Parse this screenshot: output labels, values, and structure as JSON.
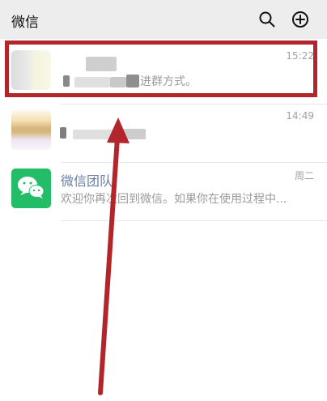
{
  "header": {
    "title": "微信",
    "search_icon": "search-icon",
    "add_icon": "plus-circle-icon"
  },
  "chats": [
    {
      "name": "",
      "time": "15:22",
      "preview": "进群方式。",
      "avatar": "blurred-avatar"
    },
    {
      "name": "",
      "time": "14:49",
      "preview": "",
      "avatar": "blurred-avatar"
    },
    {
      "name": "微信团队",
      "time": "周二",
      "preview": "欢迎你再次回到微信。如果你在使用过程中...",
      "avatar": "wechat-logo"
    }
  ],
  "colors": {
    "header_bg": "#ededed",
    "accent": "#22bd66",
    "highlight": "#b2252a",
    "name_text": "#6b7ea3",
    "muted_text": "#9a9a9a"
  }
}
